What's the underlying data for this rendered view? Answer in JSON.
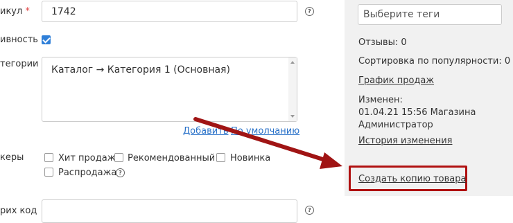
{
  "form": {
    "article_label": "икул",
    "article_required": "*",
    "article_value": "1742",
    "active_label": "ивность",
    "categories_label": "тегории",
    "categories_value": "Каталог → Категория 1 (Основная)",
    "add_link": "Добавить",
    "default_link": "По умолчанию",
    "stickers_label": "керы",
    "stickers": [
      {
        "label": "Хит продаж",
        "checked": false
      },
      {
        "label": "Рекомендованный",
        "checked": false
      },
      {
        "label": "Новинка",
        "checked": false
      },
      {
        "label": "Распродажа",
        "checked": false
      }
    ],
    "code_label": "рих код",
    "help_glyph": "?"
  },
  "sidebar": {
    "tags_placeholder": "Выберите теги",
    "reviews": "Отзывы:  0",
    "sort_popularity": "Сортировка по популярности: 0",
    "sales_chart_link": "График продаж",
    "changed_label": "Изменен:",
    "changed_date": "01.04.21 15:56 Магазина",
    "changed_by": "Администратор",
    "history_link": "История изменения",
    "copy_product_link": "Создать копию товара"
  },
  "colors": {
    "link": "#2a72c9",
    "arrow": "#a01414",
    "highlight_border": "#b01010",
    "checkbox_checked": "#2f7fd8",
    "sidebar_bg": "#f1f1f1"
  }
}
